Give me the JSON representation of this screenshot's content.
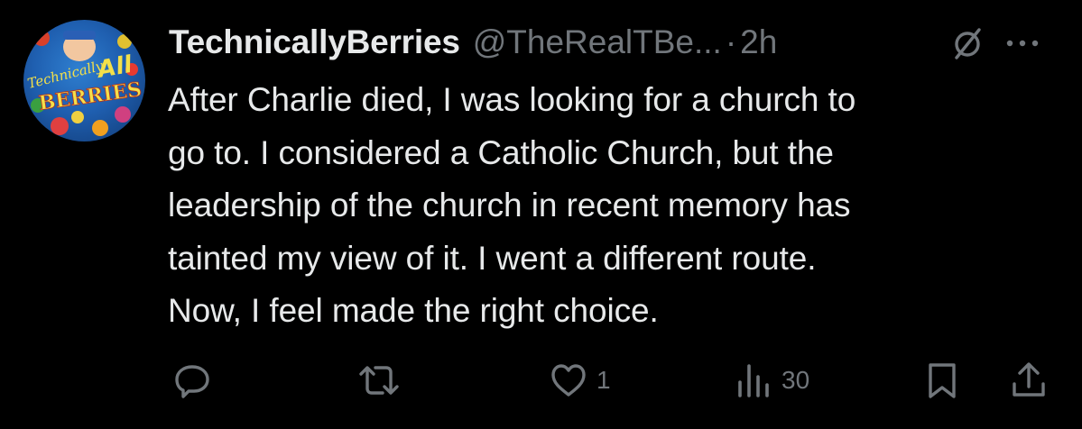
{
  "tweet": {
    "display_name": "TechnicallyBerries",
    "handle": "@TheRealTBe...",
    "separator": "·",
    "time": "2h",
    "avatar": {
      "logo_text_1": "Technically",
      "logo_text_2": "All",
      "logo_text_3": "BERRIES"
    },
    "text_lines": [
      "After Charlie died, I was looking for a church to",
      "go to. I considered a Catholic Church, but the",
      "leadership of the church in recent memory has",
      "tainted my view of it. I went a different route.",
      "Now, I feel made the right choice."
    ]
  },
  "actions": {
    "reply": {
      "icon": "reply-icon",
      "count": ""
    },
    "retweet": {
      "icon": "retweet-icon",
      "count": ""
    },
    "like": {
      "icon": "heart-icon",
      "count": "1"
    },
    "views": {
      "icon": "views-icon",
      "count": "30"
    },
    "bookmark": {
      "icon": "bookmark-icon"
    },
    "share": {
      "icon": "share-icon"
    }
  },
  "colors": {
    "background": "#000000",
    "primary_text": "#e7e9ea",
    "secondary_text": "#71767b"
  }
}
